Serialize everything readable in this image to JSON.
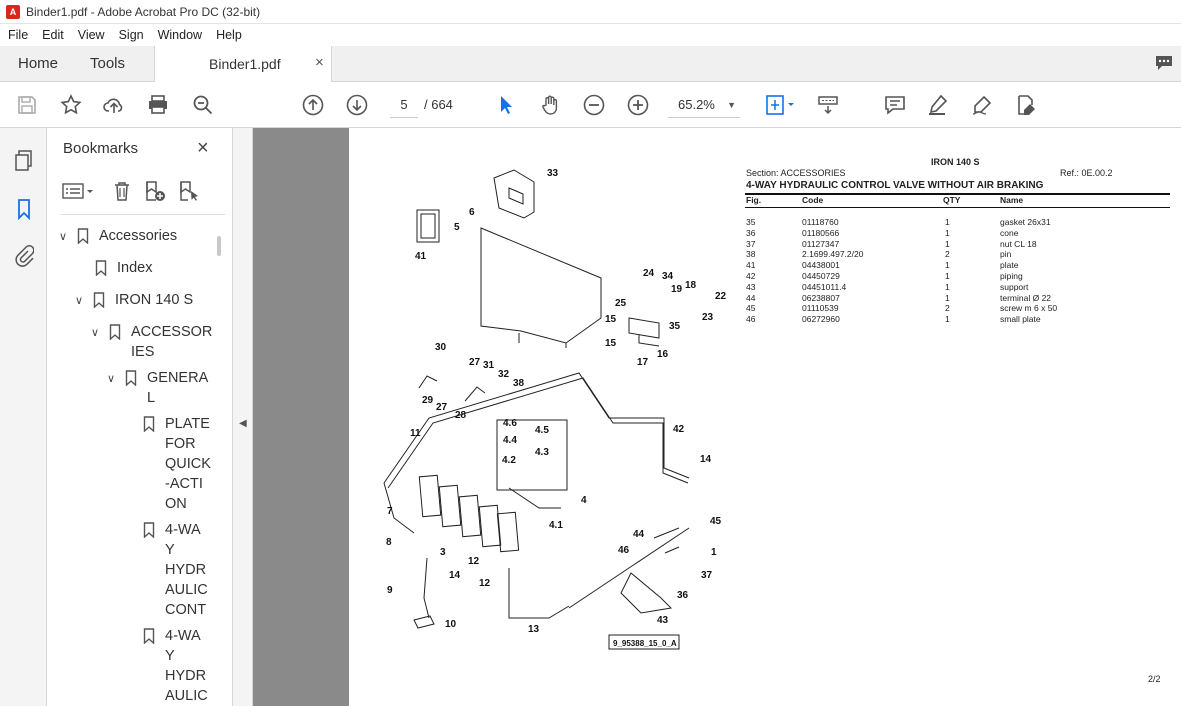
{
  "window": {
    "title": "Binder1.pdf - Adobe Acrobat Pro DC (32-bit)"
  },
  "menu": [
    "File",
    "Edit",
    "View",
    "Sign",
    "Window",
    "Help"
  ],
  "tabs": {
    "home": "Home",
    "tools": "Tools",
    "document": "Binder1.pdf",
    "close": "×"
  },
  "toolbar": {
    "page_current": "5",
    "page_total": "/ 664",
    "zoom": "65.2%"
  },
  "bookmarks": {
    "title": "Bookmarks",
    "close": "×",
    "items": [
      {
        "label": "Accessories",
        "expanded": true
      },
      {
        "label": "Index"
      },
      {
        "label": "IRON 140 S",
        "expanded": true
      },
      {
        "label": "ACCESSOR\nIES",
        "expanded": true
      },
      {
        "label": "GENERA\nL",
        "expanded": true
      },
      {
        "label": "PLATE\nFOR\nQUICK\n-ACTI\nON"
      },
      {
        "label": "4-WA\nY\nHYDR\nAULIC\nCONT"
      },
      {
        "label": "4-WA\nY\nHYDR\nAULIC"
      }
    ]
  },
  "document": {
    "product": "IRON 140 S",
    "section": "Section: ACCESSORIES",
    "ref": "Ref.: 0E.00.2",
    "heading": "4-WAY HYDRAULIC CONTROL VALVE WITHOUT AIR BRAKING",
    "columns": [
      "Fig.",
      "Code",
      "QTY",
      "Name"
    ],
    "parts": [
      {
        "fig": "35",
        "code": "01118760",
        "qty": "1",
        "name": "gasket 26x31"
      },
      {
        "fig": "36",
        "code": "01180566",
        "qty": "1",
        "name": "cone"
      },
      {
        "fig": "37",
        "code": "01127347",
        "qty": "1",
        "name": "nut CL 18"
      },
      {
        "fig": "38",
        "code": "2.1699.497.2/20",
        "qty": "2",
        "name": "pin"
      },
      {
        "fig": "41",
        "code": "04438001",
        "qty": "1",
        "name": "plate"
      },
      {
        "fig": "42",
        "code": "04450729",
        "qty": "1",
        "name": "piping"
      },
      {
        "fig": "43",
        "code": "04451011.4",
        "qty": "1",
        "name": "support"
      },
      {
        "fig": "44",
        "code": "06238807",
        "qty": "1",
        "name": "terminal Ø 22"
      },
      {
        "fig": "45",
        "code": "01110539",
        "qty": "2",
        "name": "screw m 6 x 50"
      },
      {
        "fig": "46",
        "code": "06272960",
        "qty": "1",
        "name": "small plate"
      }
    ],
    "drawing_code": "9_95388_15_0_A",
    "callouts": [
      "33",
      "6",
      "5",
      "41",
      "24",
      "34",
      "19",
      "18",
      "22",
      "25",
      "23",
      "15",
      "35",
      "15",
      "17",
      "16",
      "30",
      "27",
      "31",
      "32",
      "38",
      "29",
      "27",
      "28",
      "11",
      "4.6",
      "4.5",
      "4.4",
      "4.3",
      "4.2",
      "42",
      "14",
      "4",
      "7",
      "4.1",
      "45",
      "8",
      "3",
      "12",
      "44",
      "46",
      "1",
      "37",
      "9",
      "14",
      "12",
      "36",
      "10",
      "13",
      "43"
    ],
    "page_number": "2/2"
  },
  "colors": {
    "accent": "#1473e6",
    "gray_canvas": "#8a8a8a",
    "acrobat_red": "#d9271e"
  }
}
